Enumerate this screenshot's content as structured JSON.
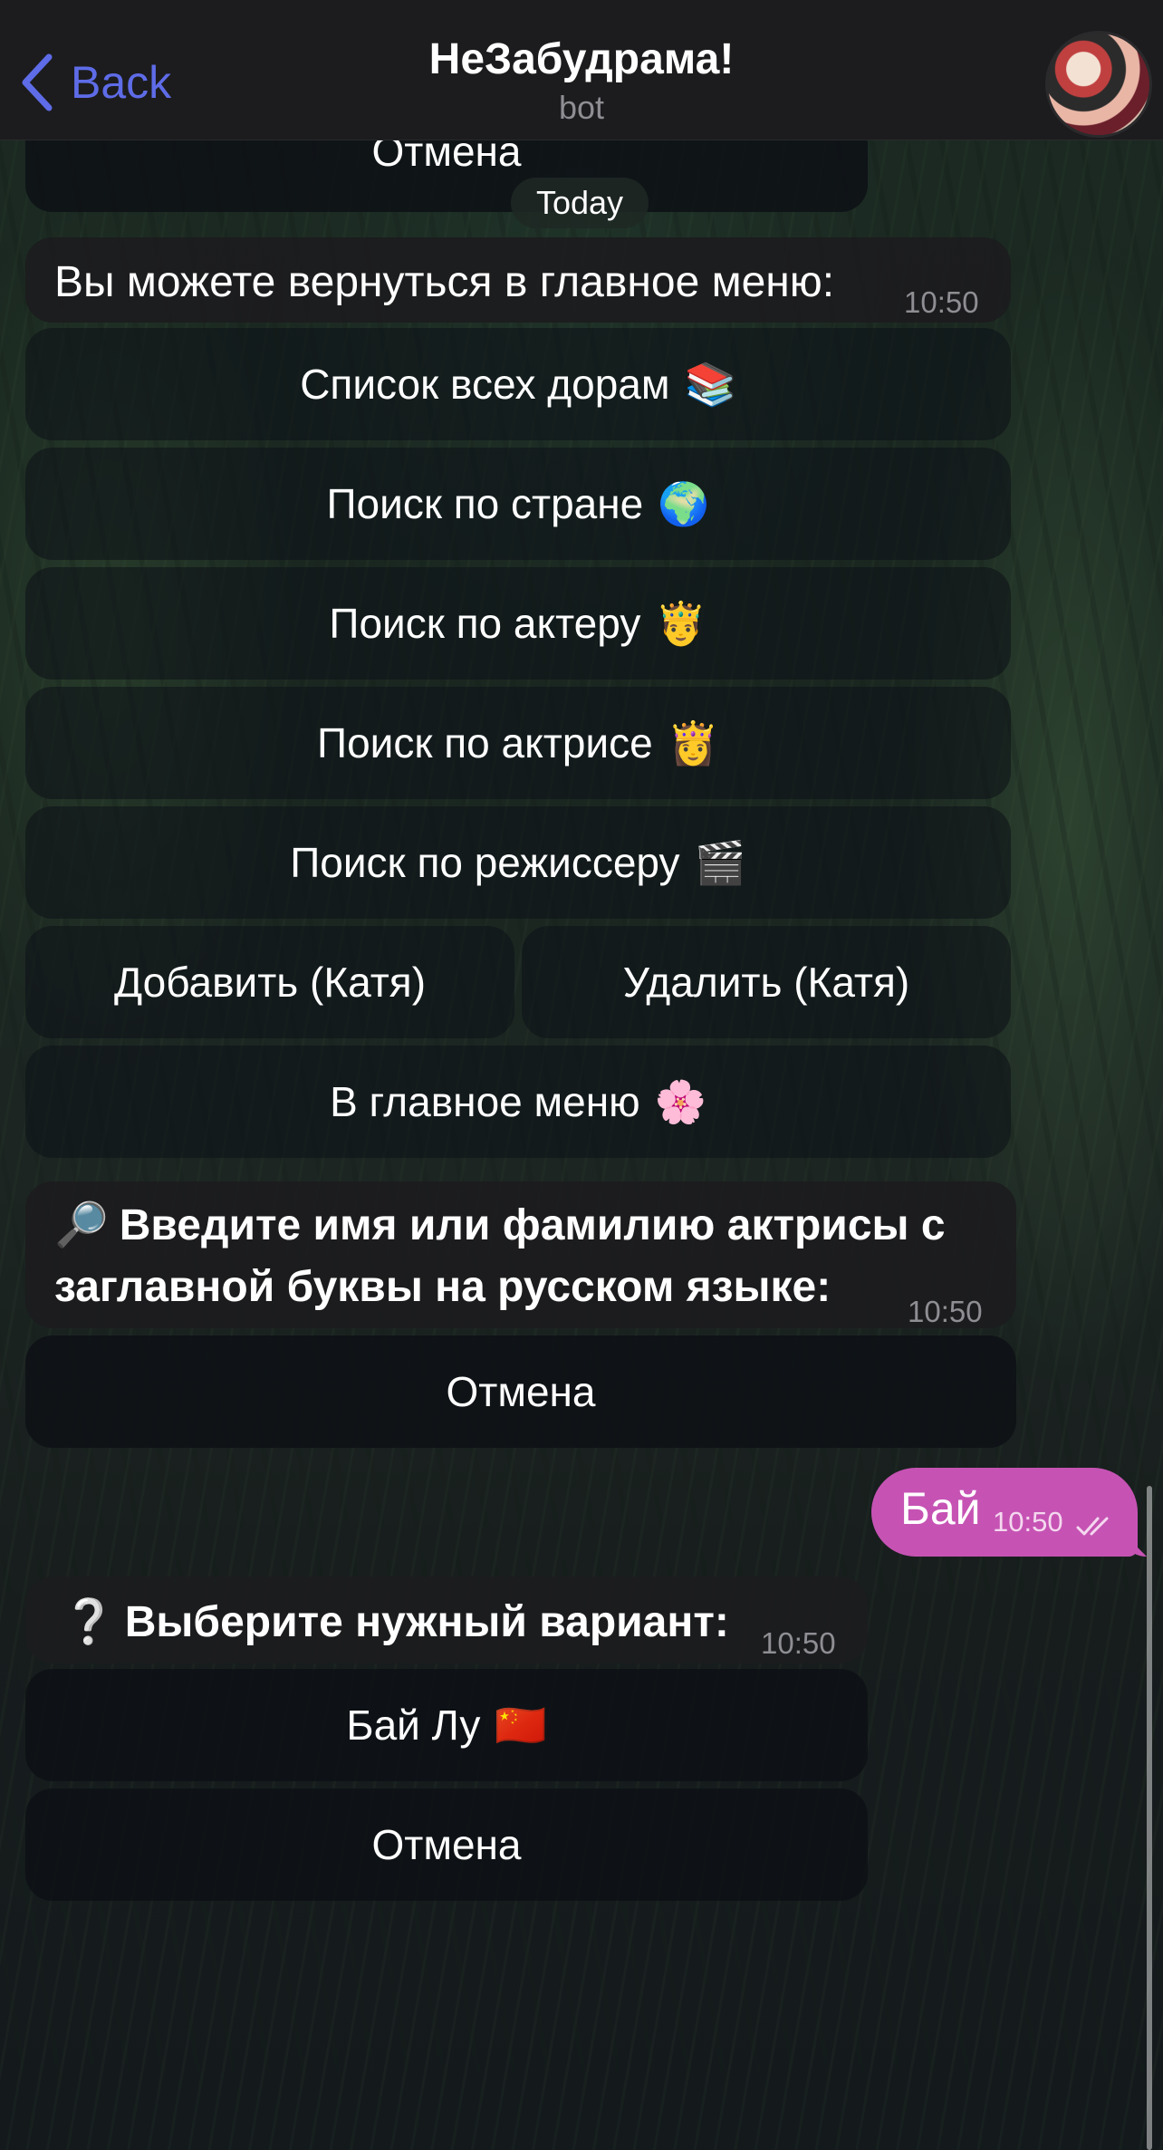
{
  "header": {
    "back_label": "Back",
    "title": "НеЗабудрама!",
    "subtitle": "bot"
  },
  "date_separator": "Today",
  "top_button": "Отмена",
  "menu_message": {
    "text": "Вы можете вернуться в главное меню:",
    "time": "10:50"
  },
  "menu_buttons": [
    {
      "label": "Список всех дорам",
      "emoji": "📚"
    },
    {
      "label": "Поиск по стране",
      "emoji": "🌍"
    },
    {
      "label": "Поиск по актеру",
      "emoji": "🤴"
    },
    {
      "label": "Поиск по актрисе",
      "emoji": "👸"
    },
    {
      "label": "Поиск по режиссеру",
      "emoji": "🎬"
    },
    {
      "label": "Добавить (Катя)"
    },
    {
      "label": "Удалить (Катя)"
    },
    {
      "label": "В главное меню",
      "emoji": "🌸"
    }
  ],
  "search_message": {
    "icon": "🔎",
    "text": "Введите имя или фамилию актрисы с заглавной буквы на русском языке:",
    "time": "10:50",
    "cancel": "Отмена"
  },
  "outgoing": {
    "text": "Бай",
    "time": "10:50",
    "status": "read"
  },
  "choice_message": {
    "icon": "❔",
    "text": "Выберите нужный вариант:",
    "time": "10:50",
    "options": [
      {
        "label": "Бай Лу",
        "emoji": "🇨🇳"
      },
      {
        "label": "Отмена"
      }
    ]
  },
  "colors": {
    "accent": "#5e6ce8",
    "outgoing_bubble": "#c653b4",
    "header_bg": "#1c1c1e"
  }
}
